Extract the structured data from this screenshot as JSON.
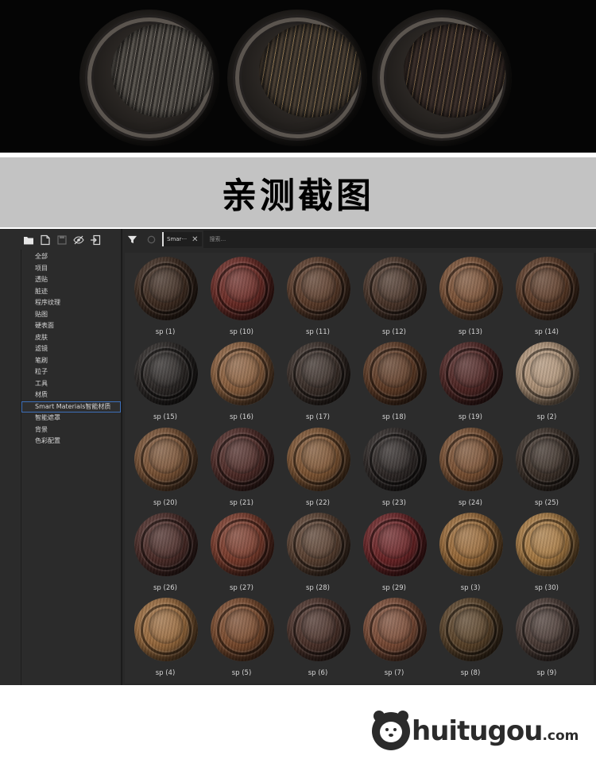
{
  "banner": {
    "title": "亲测截图"
  },
  "sidebar": {
    "toolbar": [
      "folder-icon",
      "new-file-icon",
      "save-icon",
      "hide-icon",
      "import-icon"
    ],
    "items": [
      {
        "label": "全部",
        "selected": false
      },
      {
        "label": "项目",
        "selected": false
      },
      {
        "label": "透贴",
        "selected": false
      },
      {
        "label": "脏迹",
        "selected": false
      },
      {
        "label": "程序纹理",
        "selected": false
      },
      {
        "label": "贴图",
        "selected": false
      },
      {
        "label": "硬表面",
        "selected": false
      },
      {
        "label": "皮肤",
        "selected": false
      },
      {
        "label": "滤镜",
        "selected": false
      },
      {
        "label": "笔刷",
        "selected": false
      },
      {
        "label": "粒子",
        "selected": false
      },
      {
        "label": "工具",
        "selected": false
      },
      {
        "label": "材质",
        "selected": false
      },
      {
        "label": "Smart Materials智能材质",
        "selected": true
      },
      {
        "label": "智能遮罩",
        "selected": false
      },
      {
        "label": "背景",
        "selected": false
      },
      {
        "label": "色彩配置",
        "selected": false
      }
    ]
  },
  "toolbar": {
    "filter_tag": "Smar···",
    "filter_close": "✕",
    "search_placeholder": "搜索..."
  },
  "materials": [
    {
      "label": "sp (1)",
      "color": "#3d2a1f"
    },
    {
      "label": "sp (10)",
      "color": "#6b2a24"
    },
    {
      "label": "sp (11)",
      "color": "#5a3a28"
    },
    {
      "label": "sp (12)",
      "color": "#4a3428"
    },
    {
      "label": "sp (13)",
      "color": "#7a5034"
    },
    {
      "label": "sp (14)",
      "color": "#5c3a26"
    },
    {
      "label": "sp (15)",
      "color": "#2a2624"
    },
    {
      "label": "sp (16)",
      "color": "#8a5e3c"
    },
    {
      "label": "sp (17)",
      "color": "#3a2e28"
    },
    {
      "label": "sp (18)",
      "color": "#5e3a24"
    },
    {
      "label": "sp (19)",
      "color": "#4e2422"
    },
    {
      "label": "sp (2)",
      "color": "#b09478"
    },
    {
      "label": "sp (20)",
      "color": "#7a5234"
    },
    {
      "label": "sp (21)",
      "color": "#4e2a26"
    },
    {
      "label": "sp (22)",
      "color": "#7e5432"
    },
    {
      "label": "sp (23)",
      "color": "#2c2624"
    },
    {
      "label": "sp (24)",
      "color": "#7a5032"
    },
    {
      "label": "sp (25)",
      "color": "#3c3028"
    },
    {
      "label": "sp (26)",
      "color": "#4a2a26"
    },
    {
      "label": "sp (27)",
      "color": "#7a3a2a"
    },
    {
      "label": "sp (28)",
      "color": "#5a4030"
    },
    {
      "label": "sp (29)",
      "color": "#6a2224"
    },
    {
      "label": "sp (3)",
      "color": "#9a6a38"
    },
    {
      "label": "sp (30)",
      "color": "#a87a42"
    },
    {
      "label": "sp (4)",
      "color": "#9a6a3c"
    },
    {
      "label": "sp (5)",
      "color": "#7a4a2c"
    },
    {
      "label": "sp (6)",
      "color": "#4a3028"
    },
    {
      "label": "sp (7)",
      "color": "#7a4a34"
    },
    {
      "label": "sp (8)",
      "color": "#5a4228"
    },
    {
      "label": "sp (9)",
      "color": "#4a3a34"
    }
  ],
  "logo": {
    "brand": "huitugou",
    "suffix": ".com"
  }
}
